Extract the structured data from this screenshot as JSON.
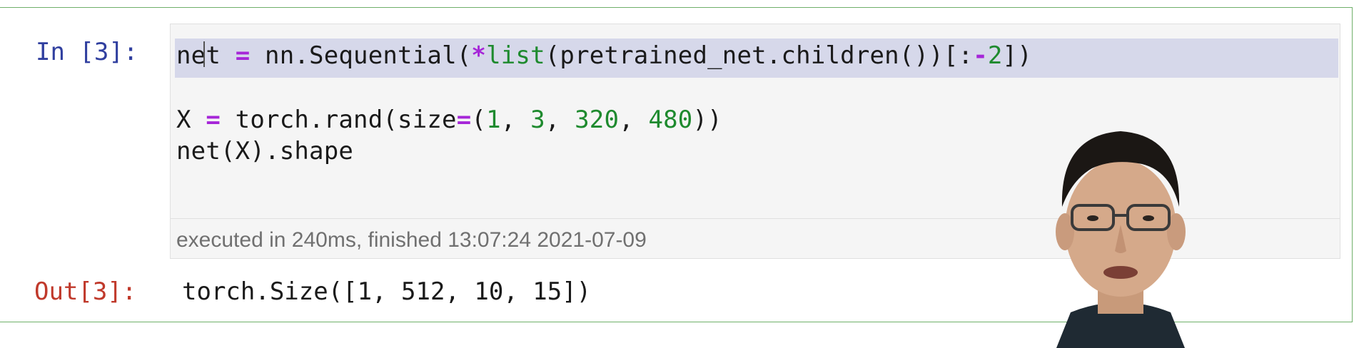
{
  "cell": {
    "in_prompt": "In [3]:",
    "out_prompt": "Out[3]:",
    "code_lines": [
      {
        "parts": [
          {
            "t": "net",
            "c": "plain"
          },
          {
            "t": " ",
            "c": "plain"
          },
          {
            "t": "=",
            "c": "op"
          },
          {
            "t": " nn.Sequential(",
            "c": "plain"
          },
          {
            "t": "*",
            "c": "op"
          },
          {
            "t": "list",
            "c": "bi"
          },
          {
            "t": "(pretrained_net.children())[:",
            "c": "plain"
          },
          {
            "t": "-",
            "c": "op"
          },
          {
            "t": "2",
            "c": "num"
          },
          {
            "t": "])",
            "c": "plain"
          }
        ]
      },
      {
        "parts": []
      },
      {
        "parts": [
          {
            "t": "X ",
            "c": "plain"
          },
          {
            "t": "=",
            "c": "op"
          },
          {
            "t": " torch.rand(size",
            "c": "plain"
          },
          {
            "t": "=",
            "c": "op"
          },
          {
            "t": "(",
            "c": "plain"
          },
          {
            "t": "1",
            "c": "num"
          },
          {
            "t": ", ",
            "c": "plain"
          },
          {
            "t": "3",
            "c": "num"
          },
          {
            "t": ", ",
            "c": "plain"
          },
          {
            "t": "320",
            "c": "num"
          },
          {
            "t": ", ",
            "c": "plain"
          },
          {
            "t": "480",
            "c": "num"
          },
          {
            "t": "))",
            "c": "plain"
          }
        ]
      },
      {
        "parts": [
          {
            "t": "net(X).shape",
            "c": "plain"
          }
        ]
      }
    ],
    "execution_info": "executed in 240ms, finished 13:07:24 2021-07-09",
    "output": "torch.Size([1, 512, 10, 15])"
  },
  "colors": {
    "in_prompt": "#303f9f",
    "out_prompt": "#c0392b",
    "operator": "#a626d8",
    "number": "#1e8a2e",
    "cell_border": "#6fb06a"
  },
  "overlay": {
    "icon": "presenter-webcam"
  }
}
